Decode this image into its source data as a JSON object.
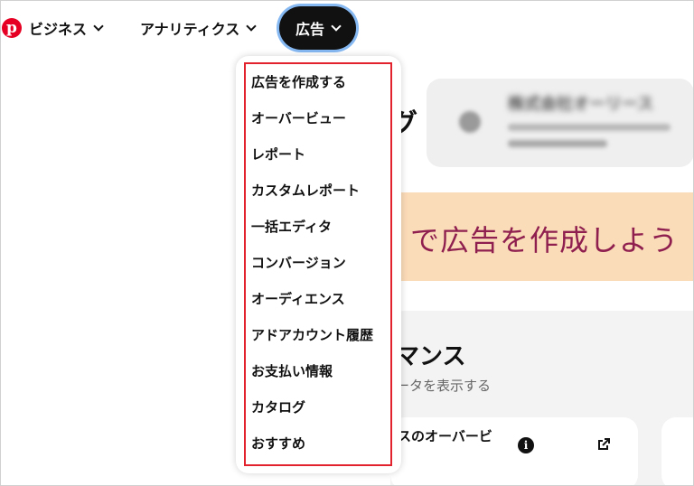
{
  "colors": {
    "brand": "#e60023",
    "active_nav_bg": "#111111",
    "focus_ring": "#86b8f2",
    "highlight_border": "#e2232e",
    "promo_bg": "#fbdcb8",
    "promo_text": "#8e1f4f"
  },
  "nav": {
    "logo_icon": "pinterest-logo-icon",
    "business_label": "ビジネス",
    "analytics_label": "アナリティクス",
    "ads_label": "広告"
  },
  "ads_menu": {
    "items": [
      "広告を作成する",
      "オーバービュー",
      "レポート",
      "カスタムレポート",
      "一括エディタ",
      "コンバージョン",
      "オーディエンス",
      "アドアカウント履歴",
      "お支払い情報",
      "カタログ",
      "おすすめ"
    ]
  },
  "background": {
    "title_fragment": "グ",
    "account_name": "株式会社オーリース",
    "promo_text": "で広告を作成しよう",
    "performance_title": "マンス",
    "performance_subtitle": "ータを表示する",
    "overview_card_title": "スのオーバービ",
    "info_icon": "info-icon",
    "external_icon": "external-link-icon"
  }
}
